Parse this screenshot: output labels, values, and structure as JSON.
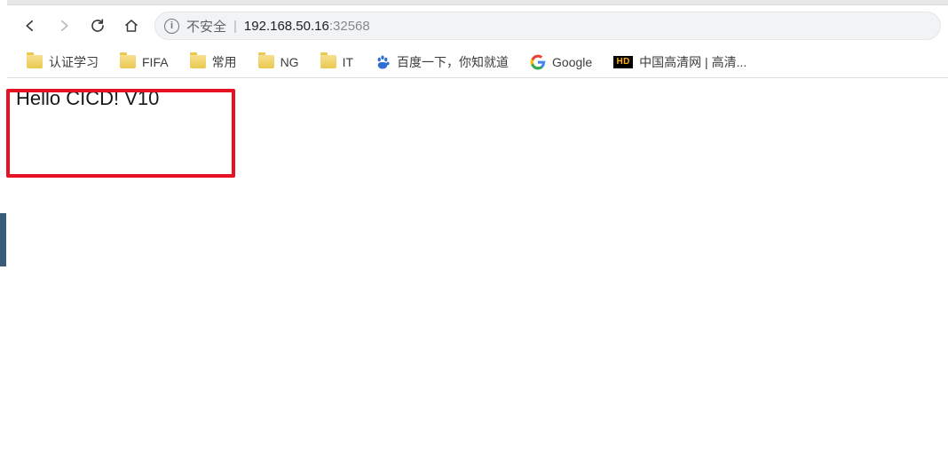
{
  "address_bar": {
    "security_label": "不安全",
    "url_host": "192.168.50.16",
    "url_port": ":32568"
  },
  "bookmarks": [
    {
      "type": "folder",
      "label": "认证学习"
    },
    {
      "type": "folder",
      "label": "FIFA"
    },
    {
      "type": "folder",
      "label": "常用"
    },
    {
      "type": "folder",
      "label": "NG"
    },
    {
      "type": "folder",
      "label": "IT"
    },
    {
      "type": "baidu",
      "label": "百度一下，你知就道"
    },
    {
      "type": "google",
      "label": "Google"
    },
    {
      "type": "hd",
      "label": "中国高清网 | 高清..."
    }
  ],
  "page": {
    "body_text": "Hello CICD! V10"
  },
  "icons": {
    "hd_text": "HD"
  }
}
